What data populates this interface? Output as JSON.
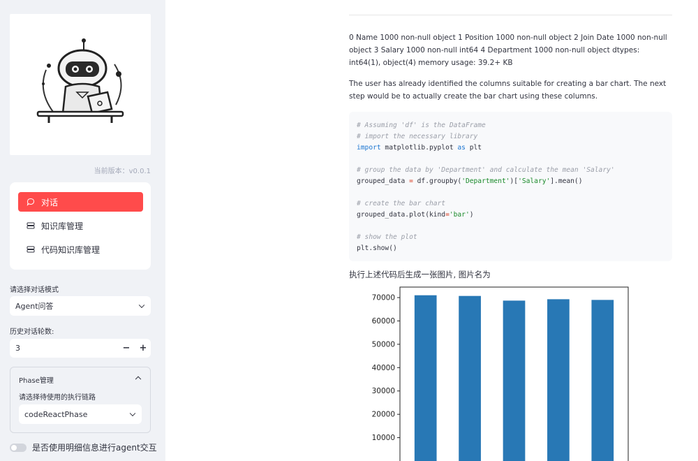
{
  "sidebar": {
    "version_label": "当前版本：v0.0.1",
    "nav": [
      {
        "label": "对话",
        "icon": "chat-icon",
        "active": true
      },
      {
        "label": "知识库管理",
        "icon": "database-icon",
        "active": false
      },
      {
        "label": "代码知识库管理",
        "icon": "database-icon",
        "active": false
      }
    ],
    "mode_label": "请选择对话模式",
    "mode_value": "Agent问答",
    "history_label": "历史对话轮数:",
    "history_value": "3",
    "minus": "−",
    "plus": "+",
    "phase": {
      "title": "Phase管理",
      "chain_label": "请选择待使用的执行链路",
      "chain_value": "codeReactPhase"
    },
    "toggle_label": "是否使用明细信息进行agent交互"
  },
  "main": {
    "info_text": "0 Name 1000 non-null object 1 Position 1000 non-null object 2 Join Date 1000 non-null object 3 Salary 1000 non-null int64 4 Department 1000 non-null object dtypes: int64(1), object(4) memory usage: 39.2+ KB",
    "note_text": "The user has already identified the columns suitable for creating a bar chart. The next step would be to actually create the bar chart using these columns.",
    "code_lines": [
      "# Assuming 'df' is the DataFrame",
      "# import the necessary library",
      "import matplotlib.pyplot as plt",
      "",
      "# group the data by 'Department' and calculate the mean 'Salary'",
      "grouped_data = df.groupby('Department')['Salary'].mean()",
      "",
      "# create the bar chart",
      "grouped_data.plot(kind='bar')",
      "",
      "# show the plot",
      "plt.show()"
    ],
    "caption": "执行上述代码后生成一张图片, 图片名为"
  },
  "chart_data": {
    "type": "bar",
    "categories": [
      "",
      "",
      "",
      "",
      ""
    ],
    "values": [
      71000,
      70700,
      68700,
      69300,
      69000
    ],
    "ylim": [
      0,
      74500
    ],
    "yticks": [
      10000,
      20000,
      30000,
      40000,
      50000,
      60000,
      70000
    ],
    "color": "#2878b5",
    "grid": false
  },
  "colors": {
    "accent": "#ff4b4b",
    "sidebar_bg": "#f0f2f6",
    "bar": "#2878b5"
  }
}
